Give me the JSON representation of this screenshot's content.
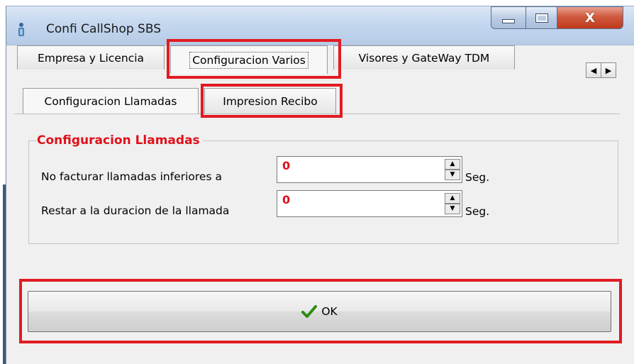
{
  "window": {
    "title": "Confi CallShop SBS",
    "controls": {
      "minimize": "minimize-icon",
      "maximize": "maximize-icon",
      "close_label": "X"
    }
  },
  "tabs": {
    "main": [
      {
        "label": "Empresa y Licencia"
      },
      {
        "label": "Configuracion Varios",
        "selected": true
      },
      {
        "label": "Visores y GateWay TDM"
      }
    ],
    "scroll_left": "◀",
    "scroll_right": "▶",
    "sub": [
      {
        "label": "Configuracion Llamadas",
        "selected": true
      },
      {
        "label": "Impresion Recibo"
      }
    ]
  },
  "group": {
    "title": "Configuracion Llamadas",
    "fields": [
      {
        "label": "No facturar llamadas inferiores a",
        "value": "0",
        "unit": "Seg."
      },
      {
        "label": "Restar a la duracion de la llamada",
        "value": "0",
        "unit": "Seg."
      }
    ]
  },
  "ok_button": {
    "label": "OK",
    "icon": "checkmark-icon"
  },
  "colors": {
    "highlight": "#e11b22",
    "group_title": "#e0101a",
    "value_text": "#e0101a",
    "checkmark": "#2e8b12"
  }
}
